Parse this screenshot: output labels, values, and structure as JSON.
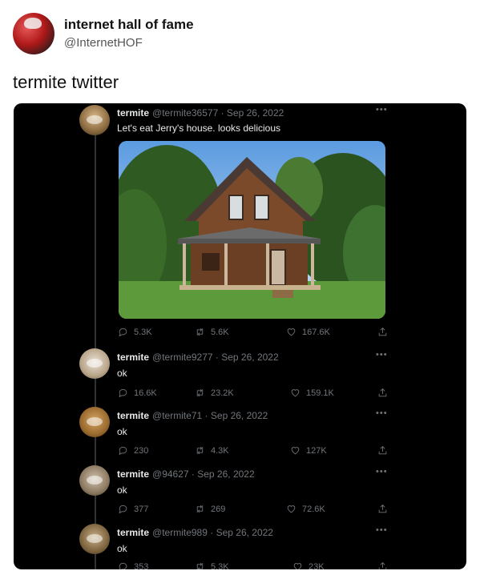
{
  "post": {
    "author_name": "internet hall of fame",
    "author_handle": "@InternetHOF",
    "caption": "termite twitter"
  },
  "thread": {
    "tweets": [
      {
        "name": "termite",
        "handle": "@termite36577",
        "date": "Sep 26, 2022",
        "text": "Let's eat Jerry's house. looks delicious",
        "replies": "5.3K",
        "retweets": "5.6K",
        "likes": "167.6K"
      },
      {
        "name": "termite",
        "handle": "@termite9277",
        "date": "Sep 26, 2022",
        "text": "ok",
        "replies": "16.6K",
        "retweets": "23.2K",
        "likes": "159.1K"
      },
      {
        "name": "termite",
        "handle": "@termite71",
        "date": "Sep 26, 2022",
        "text": "ok",
        "replies": "230",
        "retweets": "4.3K",
        "likes": "127K"
      },
      {
        "name": "termite",
        "handle": "@94627",
        "date": "Sep 26, 2022",
        "text": "ok",
        "replies": "377",
        "retweets": "269",
        "likes": "72.6K"
      },
      {
        "name": "termite",
        "handle": "@termite989",
        "date": "Sep 26, 2022",
        "text": "ok",
        "replies": "353",
        "retweets": "5.3K",
        "likes": "23K"
      }
    ]
  },
  "icons": {
    "reply": "reply-icon",
    "retweet": "retweet-icon",
    "like": "heart-icon",
    "share": "share-icon",
    "more": "more-icon"
  }
}
